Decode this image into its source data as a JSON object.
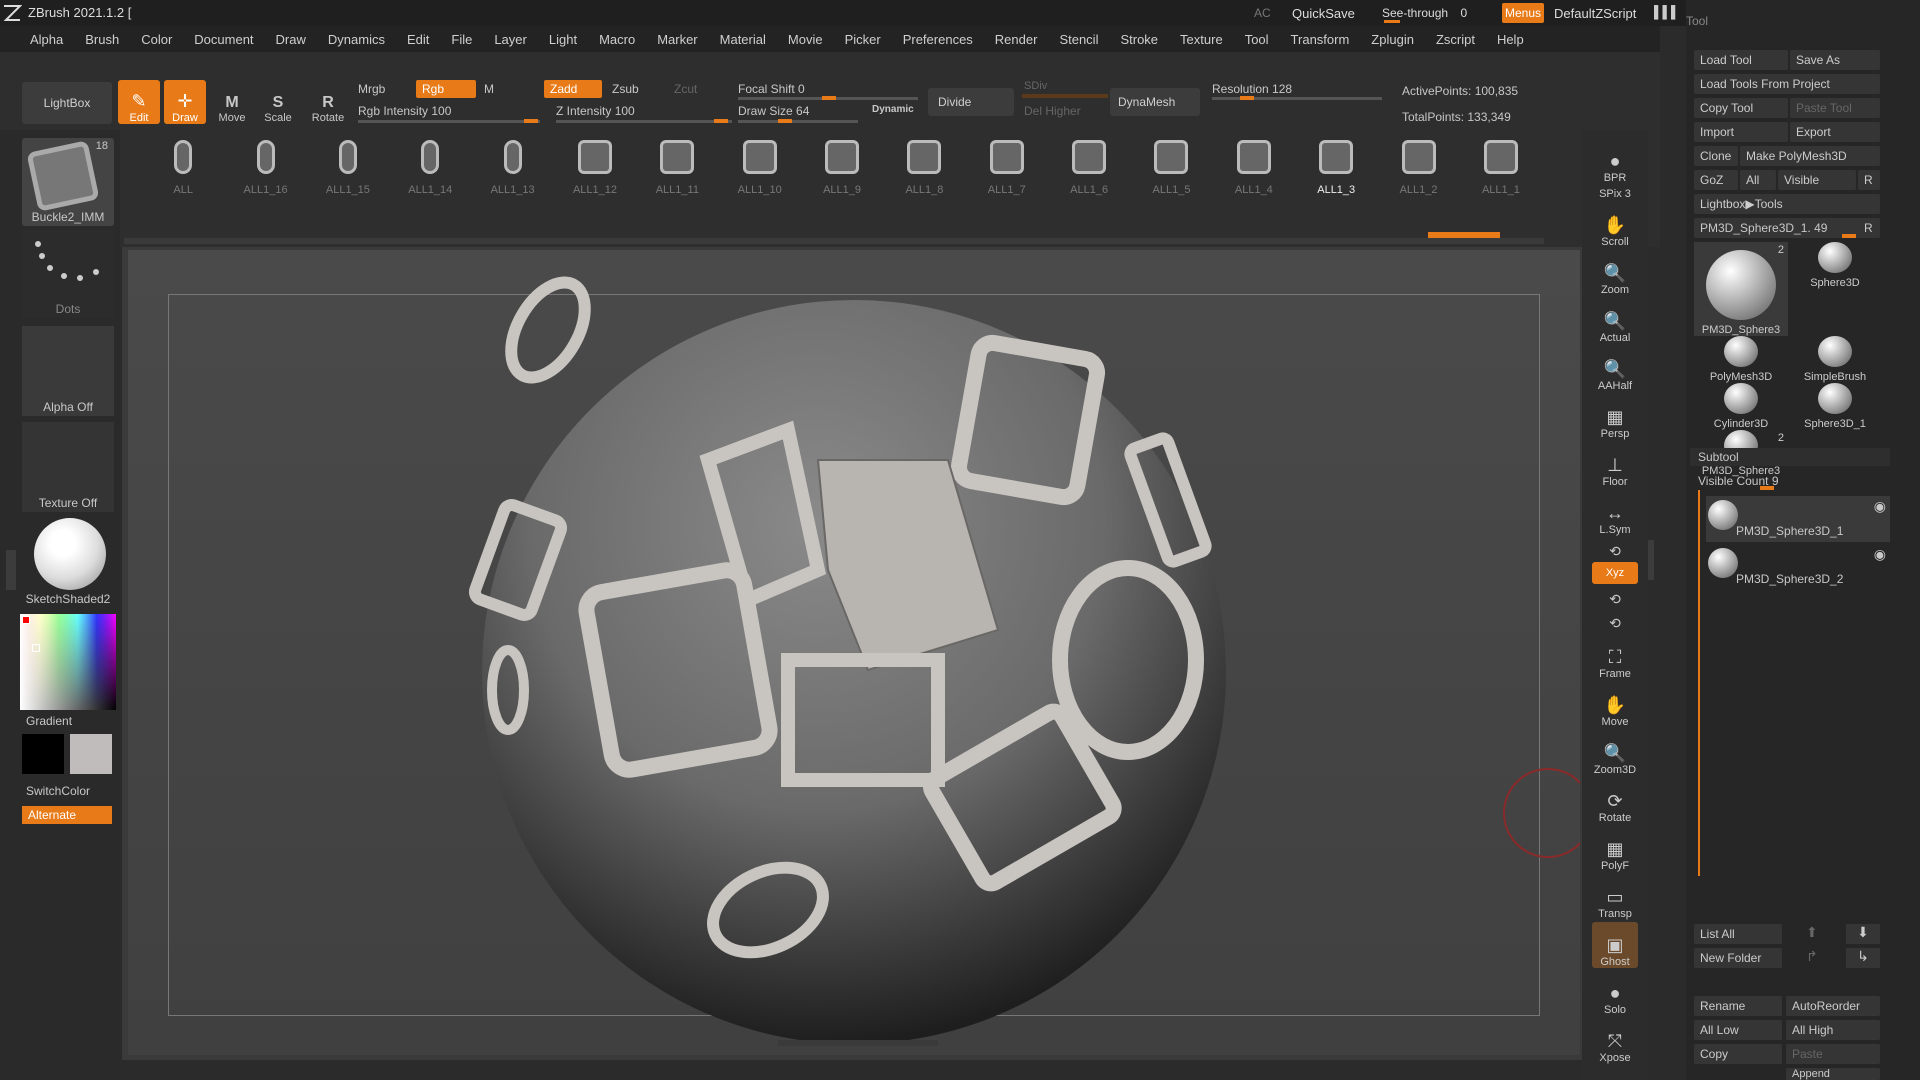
{
  "titlebar": {
    "app_title": "ZBrush 2021.1.2 [",
    "ac_label": "AC",
    "quicksave": "QuickSave",
    "seethrough_label": "See-through",
    "seethrough_value": "0",
    "menus": "Menus",
    "default_zscript": "DefaultZScript"
  },
  "menubar": [
    "Alpha",
    "Brush",
    "Color",
    "Document",
    "Draw",
    "Dynamics",
    "Edit",
    "File",
    "Layer",
    "Light",
    "Macro",
    "Marker",
    "Material",
    "Movie",
    "Picker",
    "Preferences",
    "Render",
    "Stencil",
    "Stroke",
    "Texture",
    "Tool",
    "Transform",
    "Zplugin",
    "Zscript",
    "Help"
  ],
  "toolbar": {
    "lightbox": "LightBox",
    "edit": "Edit",
    "draw": "Draw",
    "move": "Move",
    "scale": "Scale",
    "rotate": "Rotate",
    "mrgb": "Mrgb",
    "rgb": "Rgb",
    "m": "M",
    "rgb_intensity": "Rgb Intensity 100",
    "zadd": "Zadd",
    "zsub": "Zsub",
    "zcut": "Zcut",
    "z_intensity": "Z Intensity 100",
    "focal_shift": "Focal Shift 0",
    "draw_size": "Draw Size 64",
    "dynamic": "Dynamic",
    "divide": "Divide",
    "sdiv": "SDiv",
    "del_higher": "Del Higher",
    "dynamesh": "DynaMesh",
    "resolution": "Resolution 128",
    "active_points": "ActivePoints: 100,835",
    "total_points": "TotalPoints: 133,349"
  },
  "brushes": [
    "ALL",
    "ALL1_16",
    "ALL1_15",
    "ALL1_14",
    "ALL1_13",
    "ALL1_12",
    "ALL1_11",
    "ALL1_10",
    "ALL1_9",
    "ALL1_8",
    "ALL1_7",
    "ALL1_6",
    "ALL1_5",
    "ALL1_4",
    "ALL1_3",
    "ALL1_2",
    "ALL1_1"
  ],
  "leftshelf": {
    "brush_name": "Buckle2_IMM",
    "brush_count": "18",
    "stroke": "Dots",
    "alpha": "Alpha Off",
    "texture": "Texture Off",
    "material": "SketchShaded2",
    "gradient": "Gradient",
    "switchcolor": "SwitchColor",
    "alternate": "Alternate"
  },
  "rightshelf": [
    "BPR",
    "SPix 3",
    "Scroll",
    "Zoom",
    "Actual",
    "AAHalf",
    "Persp",
    "Floor",
    "L.Sym",
    "",
    "Xyz",
    "",
    "",
    "Frame",
    "Move",
    "Zoom3D",
    "Rotate",
    "PolyF",
    "Transp",
    "Ghost",
    "Solo",
    "Xpose"
  ],
  "rightpanel": {
    "load_tool": "Load Tool",
    "save_as": "Save As",
    "load_from_project": "Load Tools From Project",
    "copy_tool": "Copy Tool",
    "paste_tool": "Paste Tool",
    "import": "Import",
    "export": "Export",
    "clone": "Clone",
    "make_polymesh": "Make PolyMesh3D",
    "goz": "GoZ",
    "all": "All",
    "visible": "Visible",
    "r": "R",
    "lightbox_tools": "Lightbox▶Tools",
    "current_tool": "PM3D_Sphere3D_1. 49",
    "thumbs": [
      {
        "label": "PM3D_Sphere3",
        "badge": "2"
      },
      {
        "label": "Sphere3D",
        "badge": ""
      },
      {
        "label": "PolyMesh3D",
        "badge": ""
      },
      {
        "label": "SimpleBrush",
        "badge": ""
      },
      {
        "label": "Cylinder3D",
        "badge": ""
      },
      {
        "label": "Sphere3D_1",
        "badge": ""
      },
      {
        "label": "PM3D_Sphere3",
        "badge": "2"
      }
    ],
    "subtool": "Subtool",
    "visible_count": "Visible Count 9",
    "subtools": [
      "PM3D_Sphere3D_1",
      "PM3D_Sphere3D_2"
    ],
    "list_all": "List All",
    "new_folder": "New Folder",
    "rename": "Rename",
    "autoreorder": "AutoReorder",
    "all_low": "All Low",
    "all_high": "All High",
    "copy": "Copy",
    "paste": "Paste",
    "append": "Append",
    "panel_title": "Tool"
  },
  "colors": {
    "accent": "#e87a17",
    "panel": "#262626"
  }
}
